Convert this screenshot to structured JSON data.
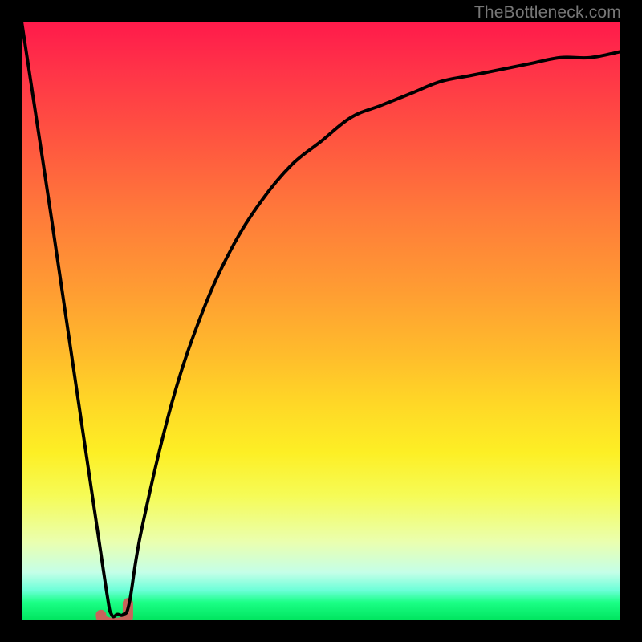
{
  "watermark": "TheBottleneck.com",
  "colors": {
    "frame": "#000000",
    "curve_stroke": "#000000",
    "marker_fill": "#c8635b",
    "marker_stroke": "#c8635b"
  },
  "chart_data": {
    "type": "line",
    "title": "",
    "xlabel": "",
    "ylabel": "",
    "xlim": [
      0,
      100
    ],
    "ylim": [
      0,
      100
    ],
    "grid": false,
    "axes_visible": false,
    "background": "rainbow-vertical-gradient (red top -> green bottom)",
    "description": "V-shaped bottleneck curve. Left branch: steep nearly-linear drop from top-left to trough. Right branch: rises from trough and asymptotically flattens toward upper-right.",
    "series": [
      {
        "name": "bottleneck-curve",
        "x": [
          0,
          5,
          10,
          14,
          15,
          16,
          17,
          18,
          20,
          25,
          30,
          35,
          40,
          45,
          50,
          55,
          60,
          65,
          70,
          75,
          80,
          85,
          90,
          95,
          100
        ],
        "y": [
          100,
          67,
          33,
          6,
          1,
          1,
          1,
          3,
          15,
          36,
          51,
          62,
          70,
          76,
          80,
          84,
          86,
          88,
          90,
          91,
          92,
          93,
          94,
          94,
          95
        ]
      }
    ],
    "marker": {
      "shape": "J-hook",
      "x_center": 15.5,
      "y_center": 1.2,
      "width": 5,
      "height": 3
    }
  }
}
